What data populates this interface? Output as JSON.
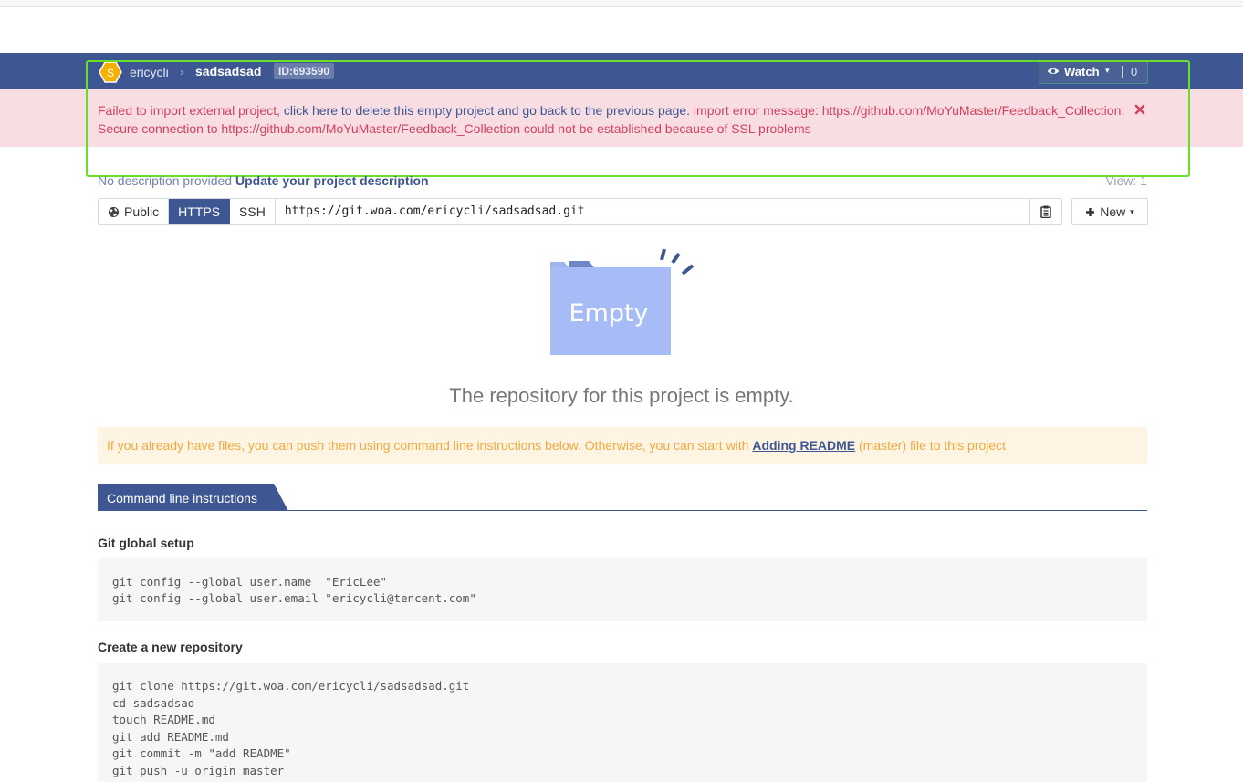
{
  "breadcrumb": {
    "avatar_letter": "S",
    "owner": "ericycli",
    "separator": "›",
    "project": "sadsadsad",
    "project_id": "ID:693590"
  },
  "watch": {
    "label": "Watch",
    "caret": "▾",
    "count": "0"
  },
  "alert": {
    "prefix": "Failed to import external project, ",
    "link": "click here to delete this empty project and go back to the previous page.",
    "message": " import error message: https://github.com/MoYuMaster/Feedback_Collection: Secure connection to https://github.com/MoYuMaster/Feedback_Collection could not be established because of SSL problems"
  },
  "description": {
    "text": "No description provided",
    "update_link": "Update your project description"
  },
  "views": "View: 1",
  "clone": {
    "public_label": "Public",
    "https_label": "HTTPS",
    "ssh_label": "SSH",
    "url": "https://git.woa.com/ericycli/sadsadsad.git"
  },
  "new_button": {
    "label": "New",
    "caret": "▾"
  },
  "empty": {
    "badge": "Empty",
    "title": "The repository for this project is empty."
  },
  "readme_hint": {
    "prefix": "If you already have files, you can push them using command line instructions below. Otherwise, you can start with ",
    "link": "Adding README",
    "suffix": " (master) file to this project"
  },
  "instructions": {
    "tab_label": "Command line instructions",
    "global_setup_title": "Git global setup",
    "global_setup_lines": [
      "git config --global user.name  \"EricLee\"",
      "git config --global user.email \"ericycli@tencent.com\""
    ],
    "create_title": "Create a new repository",
    "create_lines": [
      "git clone https://git.woa.com/ericycli/sadsadsad.git",
      "cd sadsadsad",
      "touch README.md",
      "git add README.md",
      "git commit -m \"add README\"",
      "git push -u origin master"
    ]
  },
  "colors": {
    "brand": "#3e5792",
    "alert_bg": "#f8dde2",
    "alert_text": "#d0425e",
    "warn_bg": "#fdf4e3",
    "warn_text": "#f2aa3d",
    "avatar": "#f5b000",
    "highlight": "#66e02a"
  }
}
